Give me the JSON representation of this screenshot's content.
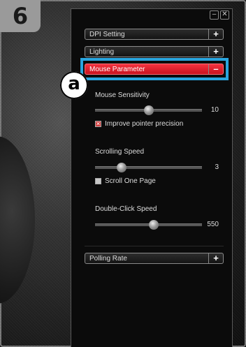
{
  "step": {
    "number": "6",
    "callout": "a"
  },
  "window": {
    "minimize": "–",
    "close": "✕"
  },
  "sections": {
    "dpi": {
      "label": "DPI Setting",
      "toggle": "+"
    },
    "lighting": {
      "label": "Lighting",
      "toggle": "+"
    },
    "mouse_parameter": {
      "label": "Mouse Parameter",
      "toggle": "–"
    },
    "polling": {
      "label": "Polling Rate",
      "toggle": "+"
    }
  },
  "mouse_parameter": {
    "sensitivity": {
      "label": "Mouse Sensitivity",
      "value": "10",
      "level": 0.5
    },
    "precision": {
      "label": "Improve pointer precision",
      "checked": true
    },
    "scroll_speed": {
      "label": "Scrolling Speed",
      "value": "3",
      "level": 0.25
    },
    "scroll_one_page": {
      "label": "Scroll One Page",
      "checked": false
    },
    "double_click": {
      "label": "Double-Click Speed",
      "value": "550",
      "level": 0.55
    }
  },
  "colors": {
    "active": "#e31c2a",
    "highlight": "#2aa5de"
  }
}
